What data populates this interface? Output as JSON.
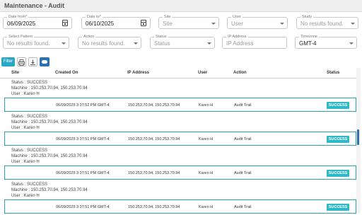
{
  "header": {
    "title": "Maintenance - Audit"
  },
  "filters": {
    "date_from": {
      "label": "Date from*",
      "value": "06/09/2025"
    },
    "date_to": {
      "label": "Date to*",
      "value": "06/10/2025"
    },
    "site": {
      "label": "Site",
      "placeholder": "Site"
    },
    "user": {
      "label": "User",
      "placeholder": "User"
    },
    "study": {
      "label": "Study",
      "placeholder": "No results found."
    },
    "select_patient": {
      "label": "Select Patient",
      "placeholder": "No results found."
    },
    "action": {
      "label": "Action",
      "placeholder": "No results found."
    },
    "status": {
      "label": "Status",
      "placeholder": "Status"
    },
    "ip_address": {
      "label": "IP Address",
      "placeholder": "IP Address"
    },
    "timezone": {
      "label": "Timezone",
      "value": "GMT-4"
    }
  },
  "toolbar": {
    "filter_label": "Filter",
    "print_icon": "printer-icon",
    "download_icon": "download-icon",
    "toggle_icon": "toggle-icon"
  },
  "table": {
    "columns": [
      "Site",
      "Created On",
      "IP Address",
      "User",
      "Action",
      "Status"
    ],
    "rows": [
      {
        "details": [
          "Status : SUCCESS",
          "Machine : 150.253.70.94, 150.253.70.94",
          "User : Karen H"
        ],
        "created_on": "06/09/2025 3:37:52 PM GMT-4",
        "ip": "150.253.70.94, 150.253.70.94",
        "user": "Karen H",
        "action": "Audit Trail",
        "status": "SUCCESS"
      },
      {
        "details": [
          "Status : SUCCESS",
          "Machine : 150.253.70.94, 150.253.70.94",
          "User : Karen H"
        ],
        "created_on": "06/09/2025 3:37:51 PM GMT-4",
        "ip": "150.253.70.94, 150.253.70.94",
        "user": "Karen H",
        "action": "Audit Trail",
        "status": "SUCCESS"
      },
      {
        "details": [
          "Status : SUCCESS",
          "Machine : 150.253.70.94, 150.253.70.94",
          "User : Karen H"
        ],
        "created_on": "06/09/2025 3:37:51 PM GMT-4",
        "ip": "150.253.70.94, 150.253.70.94",
        "user": "Karen H",
        "action": "Audit Trail",
        "status": "SUCCESS"
      },
      {
        "details": [
          "Status : SUCCESS",
          "Machine : 150.253.70.94, 150.253.70.94",
          "User : Karen H"
        ],
        "created_on": "06/09/2025 3:37:51 PM GMT-4",
        "ip": "150.253.70.94, 150.253.70.94",
        "user": "Karen H",
        "action": "Audit Trail",
        "status": "SUCCESS"
      }
    ]
  },
  "colors": {
    "accent": "#2aa7c6",
    "row_border": "#2aa3b3",
    "badge": "#2fb8c6",
    "toggle": "#2e6fb2"
  }
}
